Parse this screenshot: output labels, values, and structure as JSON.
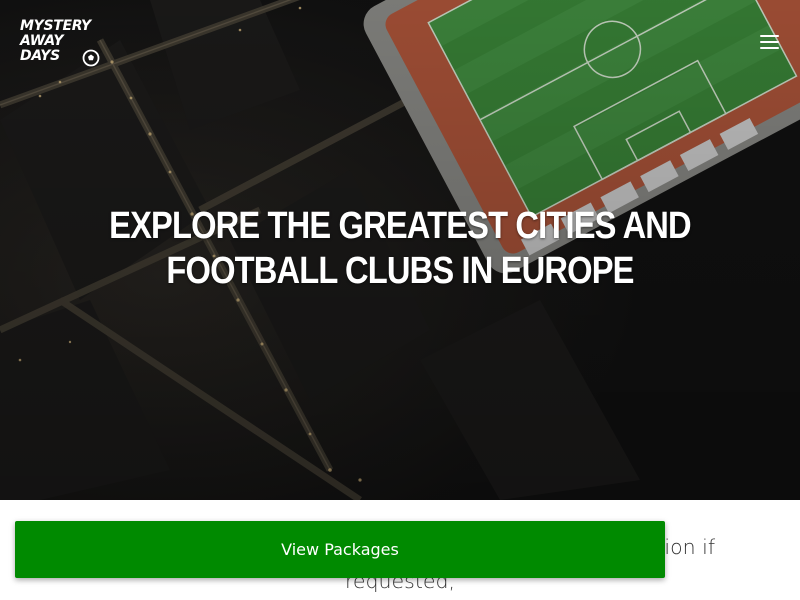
{
  "brand": {
    "logo_lines": [
      "MYSTERY",
      "AWAY",
      "DAYS"
    ]
  },
  "nav": {
    "menu_icon": "hamburger-menu-icon"
  },
  "hero": {
    "headline": "EXPLORE THE GREATEST CITIES AND FOOTBALL CLUBS IN EUROPE"
  },
  "intro": {
    "visible_text": "rience, our packages include return flights, accommodation if requested,"
  },
  "cta": {
    "label": "View Packages"
  },
  "colors": {
    "cta_background": "#008a00",
    "pitch_green": "#3c8a3a",
    "running_track": "#b4583c",
    "hero_dark": "#141414",
    "text_white": "#ffffff"
  }
}
